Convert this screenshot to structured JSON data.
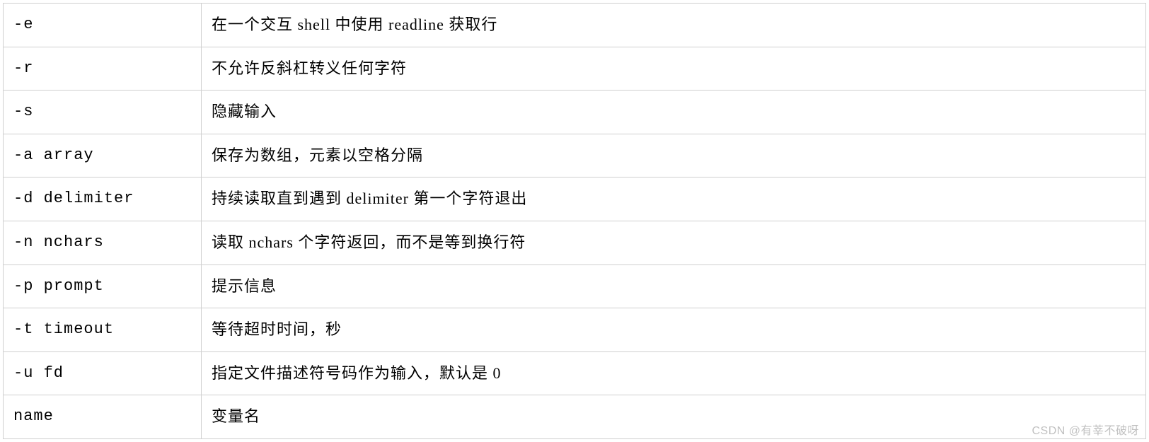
{
  "table": {
    "rows": [
      {
        "option": "-e",
        "description": "在一个交互 shell 中使用 readline 获取行"
      },
      {
        "option": "-r",
        "description": "不允许反斜杠转义任何字符"
      },
      {
        "option": "-s",
        "description": "隐藏输入"
      },
      {
        "option": "-a array",
        "description": "保存为数组，元素以空格分隔"
      },
      {
        "option": "-d delimiter",
        "description": "持续读取直到遇到 delimiter 第一个字符退出"
      },
      {
        "option": "-n nchars",
        "description": "读取 nchars 个字符返回，而不是等到换行符"
      },
      {
        "option": "-p prompt",
        "description": "提示信息"
      },
      {
        "option": "-t timeout",
        "description": "等待超时时间，秒"
      },
      {
        "option": "-u fd",
        "description": "指定文件描述符号码作为输入，默认是 0"
      },
      {
        "option": "name",
        "description": "变量名"
      }
    ]
  },
  "watermark": "CSDN @有莘不破呀"
}
